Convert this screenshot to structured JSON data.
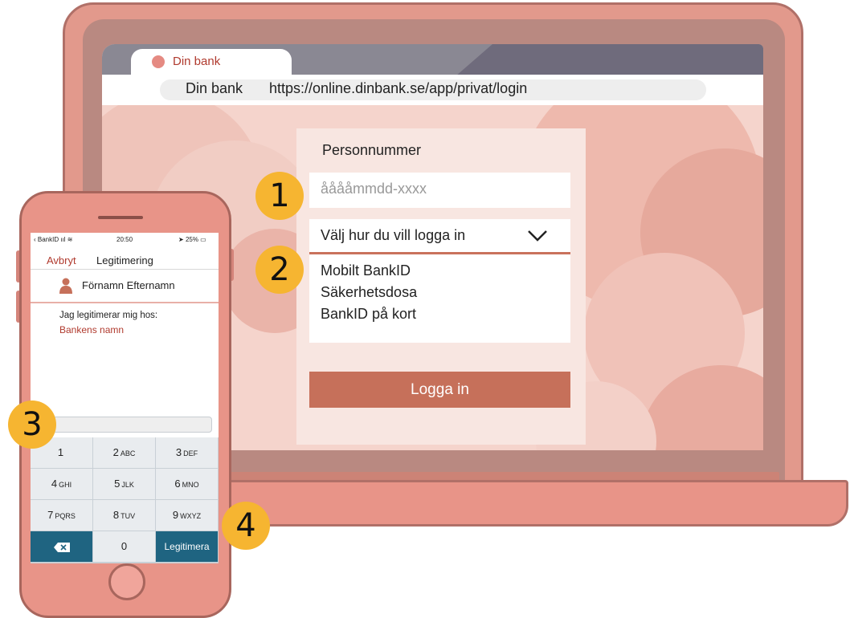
{
  "colors": {
    "brand": "#c6705a",
    "accent_red": "#b03a2e",
    "badge": "#f6b531",
    "keypad_dark": "#1f6481"
  },
  "browser": {
    "tab_title": "Din bank",
    "url_site": "Din bank",
    "url": "https://online.dinbank.se/app/privat/login"
  },
  "login": {
    "personnummer_label": "Personnummer",
    "personnummer_placeholder": "ååååmmdd-xxxx",
    "method_select": "Välj hur du vill logga in",
    "method_options": [
      "Mobilt BankID",
      "Säkerhetsdosa",
      "BankID på kort"
    ],
    "login_button": "Logga in"
  },
  "phone": {
    "status": {
      "carrier": "BankID",
      "time": "20:50",
      "battery": "25%"
    },
    "nav_cancel": "Avbryt",
    "nav_title": "Legitimering",
    "user_name": "Förnamn Efternamn",
    "identify_text": "Jag legitimerar mig hos:",
    "bank_name": "Bankens namn",
    "keys": [
      {
        "n": "1",
        "l": ""
      },
      {
        "n": "2",
        "l": "ABC"
      },
      {
        "n": "3",
        "l": "DEF"
      },
      {
        "n": "4",
        "l": "GHI"
      },
      {
        "n": "5",
        "l": "JLK"
      },
      {
        "n": "6",
        "l": "MNO"
      },
      {
        "n": "7",
        "l": "PQRS"
      },
      {
        "n": "8",
        "l": "TUV"
      },
      {
        "n": "9",
        "l": "WXYZ"
      }
    ],
    "key_zero": "0",
    "key_confirm": "Legitimera"
  },
  "badges": [
    "1",
    "2",
    "3",
    "4"
  ]
}
